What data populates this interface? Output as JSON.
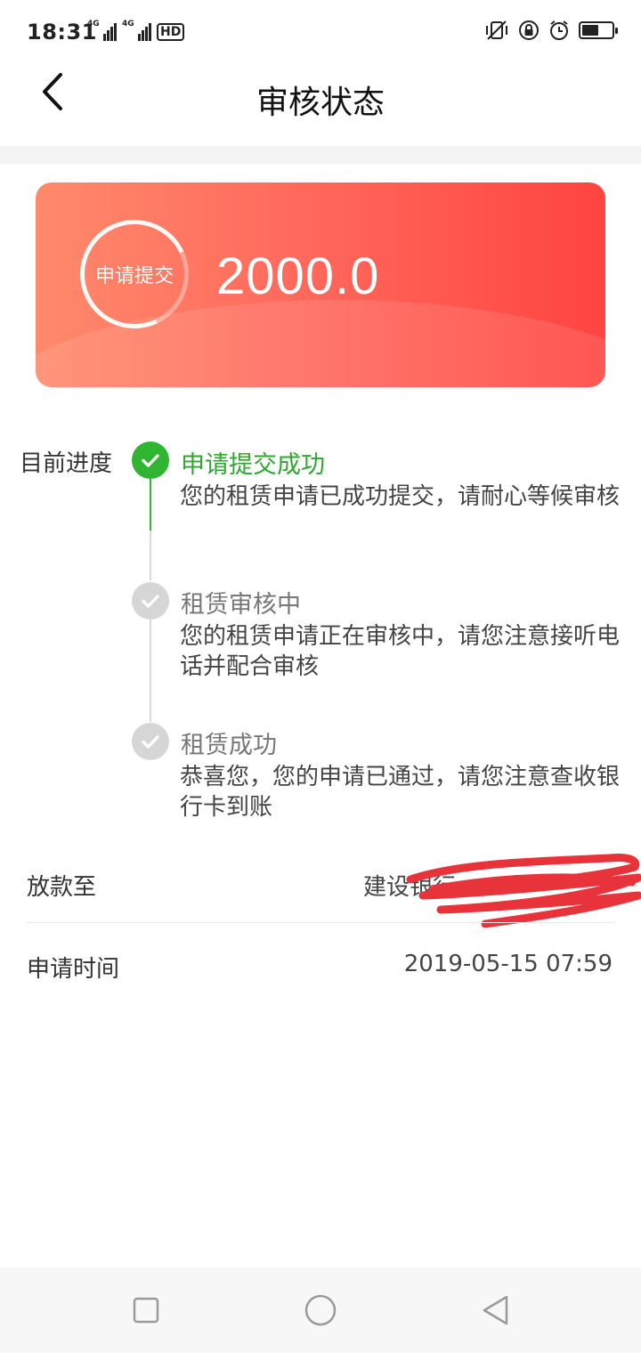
{
  "status_bar": {
    "time": "18:31",
    "signal1_tag": "4G",
    "signal2_tag": "4G",
    "hd_badge": "HD",
    "icons": [
      "vibrate-off-icon",
      "lock-rotation-icon",
      "alarm-icon",
      "battery-icon"
    ]
  },
  "header": {
    "back_icon": "chevron-left-icon",
    "title": "审核状态"
  },
  "card": {
    "status_label": "申请提交",
    "amount": "2000.0",
    "colors": {
      "gradient_start": "#ff8a6b",
      "gradient_end": "#ff4440"
    }
  },
  "progress": {
    "label": "目前进度",
    "steps": [
      {
        "title": "申请提交成功",
        "description": "您的租赁申请已成功提交，请耐心等候审核",
        "state": "done"
      },
      {
        "title": "租赁审核中",
        "description": "您的租赁申请正在审核中，请您注意接听电话并配合审核",
        "state": "pending"
      },
      {
        "title": "租赁成功",
        "description": "恭喜您，您的申请已通过，请您注意查收银行卡到账",
        "state": "pending"
      }
    ],
    "colors": {
      "done": "#2fb52f",
      "pending": "#d6d6d6"
    }
  },
  "info": {
    "payout": {
      "label": "放款至",
      "value": "建设银行"
    },
    "apply_time": {
      "label": "申请时间",
      "value": "2019-05-15 07:59"
    }
  },
  "nav_bar": {
    "icons": [
      "square-icon",
      "circle-icon",
      "triangle-back-icon"
    ]
  }
}
